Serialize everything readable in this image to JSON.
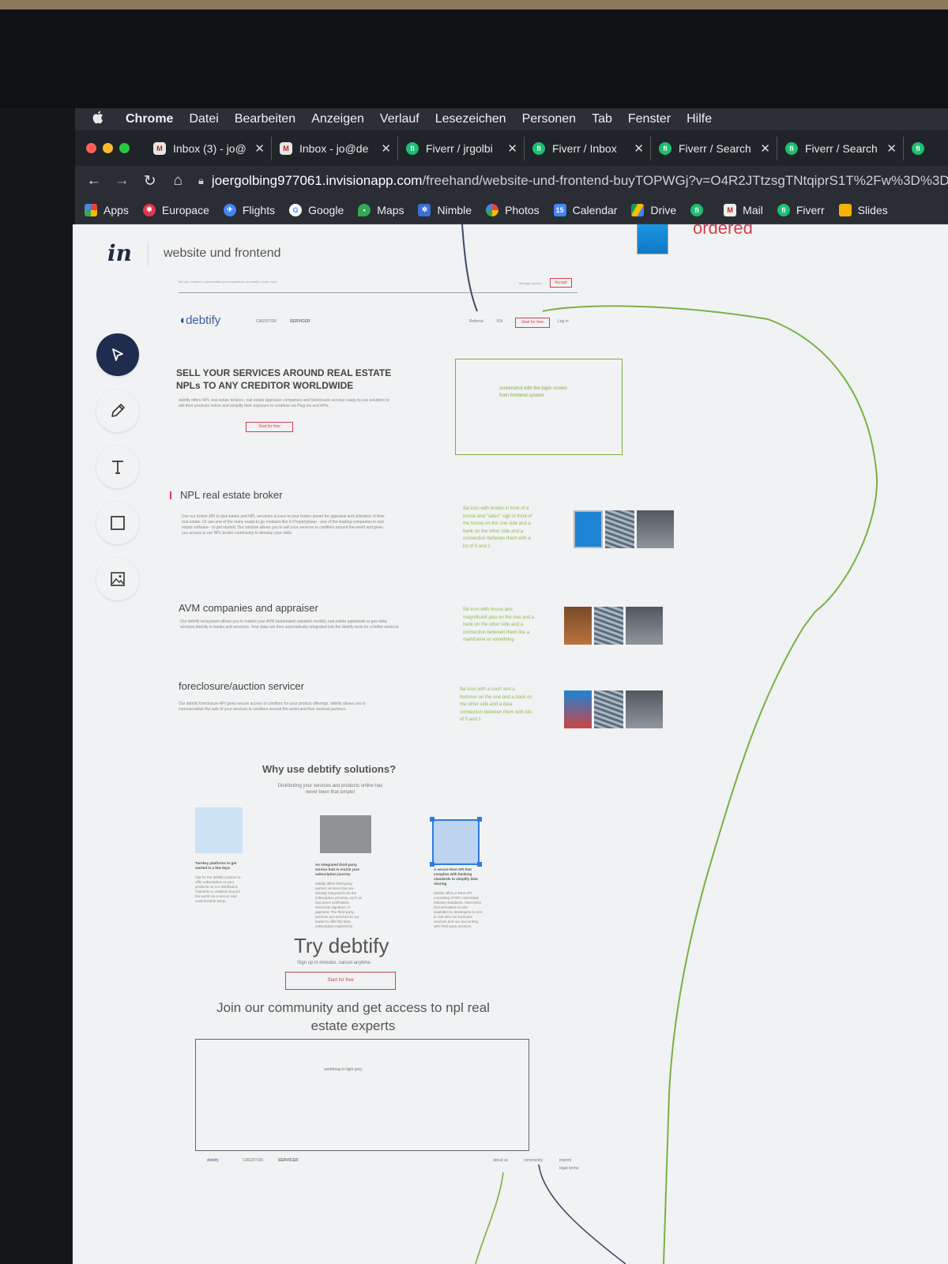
{
  "menubar": {
    "apple": "",
    "items": [
      "Chrome",
      "Datei",
      "Bearbeiten",
      "Anzeigen",
      "Verlauf",
      "Lesezeichen",
      "Personen",
      "Tab",
      "Fenster",
      "Hilfe"
    ]
  },
  "tabs": [
    {
      "title": "Inbox (3) - jo@",
      "icon": "gmail-icon"
    },
    {
      "title": "Inbox - jo@de",
      "icon": "gmail-icon"
    },
    {
      "title": "Fiverr / jrgolbi",
      "icon": "fiverr-icon"
    },
    {
      "title": "Fiverr / Inbox",
      "icon": "fiverr-icon"
    },
    {
      "title": "Fiverr / Search",
      "icon": "fiverr-icon"
    },
    {
      "title": "Fiverr / Search",
      "icon": "fiverr-icon"
    }
  ],
  "address": {
    "domain": "joergolbing977061.invisionapp.com",
    "path": "/freehand/website-und-frontend-buyTOPWGj?v=O4R2JTtzsgTNtqiprS1T%2Fw%3D%3D&"
  },
  "bookmarks": [
    "Apps",
    "Europace",
    "Flights",
    "Google",
    "Maps",
    "Nimble",
    "Photos",
    "Calendar",
    "Drive",
    "",
    "Mail",
    "Fiverr",
    "Slides"
  ],
  "calendar_day": "15",
  "invision": {
    "logo": "in",
    "title": "website und frontend",
    "tools": [
      "select-tool",
      "pen-tool",
      "text-tool",
      "rectangle-tool",
      "image-tool"
    ]
  },
  "annotations": {
    "ordered": "ordered"
  },
  "mock": {
    "cookie_text": "We use cookies to personalise your experience on debtify. Learn more",
    "manage_cookies": "Manage cookies",
    "accept": "Accept",
    "brand": "debtify",
    "nav": [
      "CREDITOR",
      "SERVICER"
    ],
    "nav_right": [
      "Referral",
      "EN"
    ],
    "start_free_small": "Start for free",
    "login": "Log in",
    "hero_title": "SELL YOUR SERVICES AROUND REAL ESTATE NPLs TO ANY CREDITOR WORLDWIDE",
    "hero_text": "debtify offers NPL real estate brokers, real estate appraiser companies and foreclosure servicer ready-to-use solutions to sell their products online and simplify their exposure to creditors via Plug-ins and APIs.",
    "hero_btn": "Start for free",
    "hero_note": "screenshot with the login screen from frontend system",
    "sections": [
      {
        "title": "NPL real estate broker",
        "text": "Use our broker API to give banks and NPL servicers access to your broker power for appraisal and utilization of their real estate. Or use one of the many ready-to-go modules like in Propertybase - one of the leading companies in real estate software - to get started. Our solution allows you to sell your services to creditors around the world and gives you access to our NPL broker community to develop your skills.",
        "note": "flat icon with broker in front of a house and \"sales\" sign in front of the house on the one side and a bank on the other side and a connection between them with a lot of 0 and 1"
      },
      {
        "title": "AVM companies and appraiser",
        "text": "Our debtify ecosystem allows you to market your AVM (automated valuation model), real estate appraisals or geo-data services directly to banks and servicers. Your data can then automatically integrated into the debtify tools for a better workout.",
        "note": "flat icon with house and magnificent glas on the one and a bank on the other side and a connection between them like a mainframe or something"
      },
      {
        "title": "foreclosure/auction servicer",
        "text": "Our debtify foreclosure API gives secure access to creditors for your product offerings. debtify allows you to commercialize the sale of your services to creditors around the world and their workout partners.",
        "note": "flat icon with a court and a hammer on the one and a bank on the other side and a data connection between them with lots of 0 and 1"
      }
    ],
    "why_title": "Why use debtify solutions?",
    "why_sub": "Distributing your services and products online has never been that simple!",
    "features": [
      {
        "title": "Turnkey platforms to get started in a few days",
        "text": "Opt for the debtify solution to offer subscription to your products on our distribution channels to creditors around the world via a secure and customizable setup."
      },
      {
        "title": "An integrated third-party service hub to enrich your subscription journey",
        "text": "debtify offers third party partner services that are already integrated into the subscription process, such as document verification, electronic signature or payment. The third-party services are enriched to our banks to offer the best subscription experience."
      },
      {
        "title": "A secure Rest API that complies with banking standards to simplify data sharing",
        "text": "debtify offers a Rest API consisting of NPL real estate industry standards. Interactive documentation is also available for developers to test in real time our business services and our accounting with third-party systems."
      }
    ],
    "try_title": "Try debtify",
    "try_sub": "Sign up in minutes, cancel anytime.",
    "try_btn": "Start for free",
    "join": "Join our community and get access to npl real estate experts",
    "worldmap_note": "worldmap in light grey",
    "footer": {
      "brand": "debtify",
      "links_left": [
        "CREDITOR",
        "SERVICER"
      ],
      "links_right": [
        "about us",
        "community",
        "imprint",
        "legal terms"
      ]
    }
  },
  "colors": {
    "menubar": "#2c2f36",
    "canvas": "#f1f2f3",
    "accent_red": "#d04050",
    "note_green": "#7fae45",
    "brand_blue": "#3b5ea0",
    "tool_active": "#1f2c4d"
  }
}
